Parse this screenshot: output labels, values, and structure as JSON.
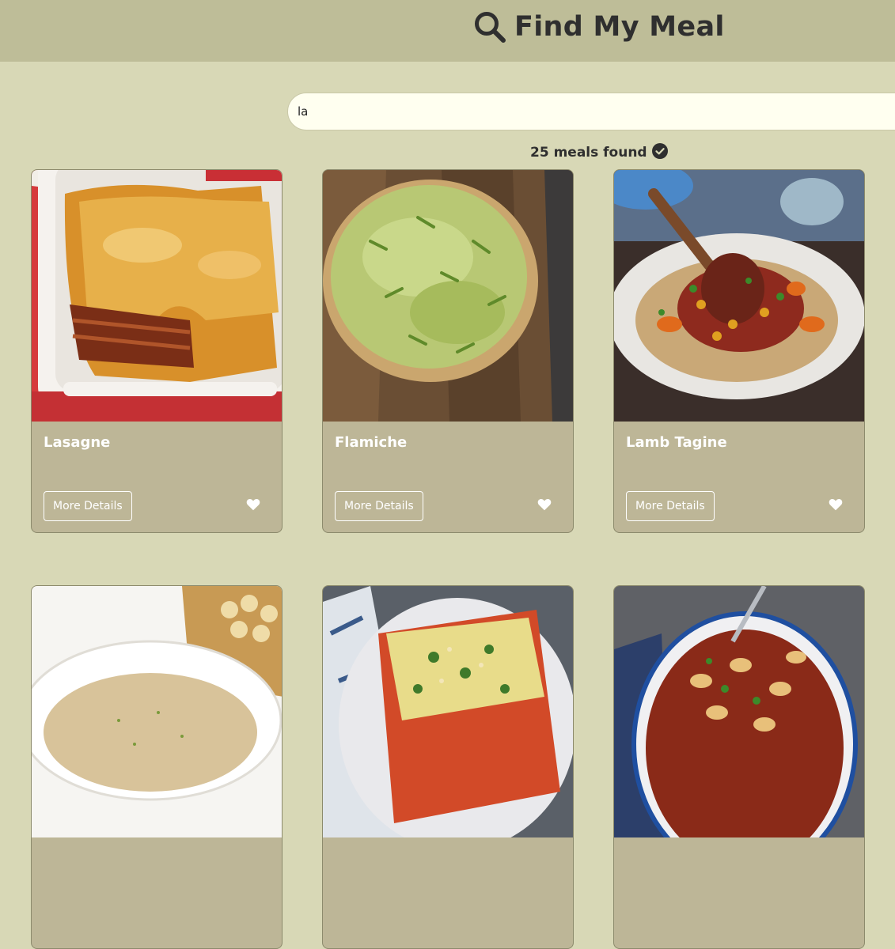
{
  "app": {
    "title": "Find My Meal",
    "icon": "search-icon"
  },
  "search": {
    "value": "la",
    "placeholder": ""
  },
  "results": {
    "status_text": "25 meals found",
    "status_icon": "check-circle-icon"
  },
  "card_actions": {
    "details_label": "More Details",
    "favorite_icon": "heart-icon"
  },
  "meals": [
    {
      "name": "Lasagne"
    },
    {
      "name": "Flamiche"
    },
    {
      "name": "Lamb Tagine"
    },
    {
      "name": ""
    },
    {
      "name": ""
    },
    {
      "name": ""
    }
  ],
  "colors": {
    "background": "#d8d8b6",
    "header": "#bebd98",
    "card": "#bdb697",
    "search_bg": "#fffff0",
    "text": "#2f2f2f"
  }
}
